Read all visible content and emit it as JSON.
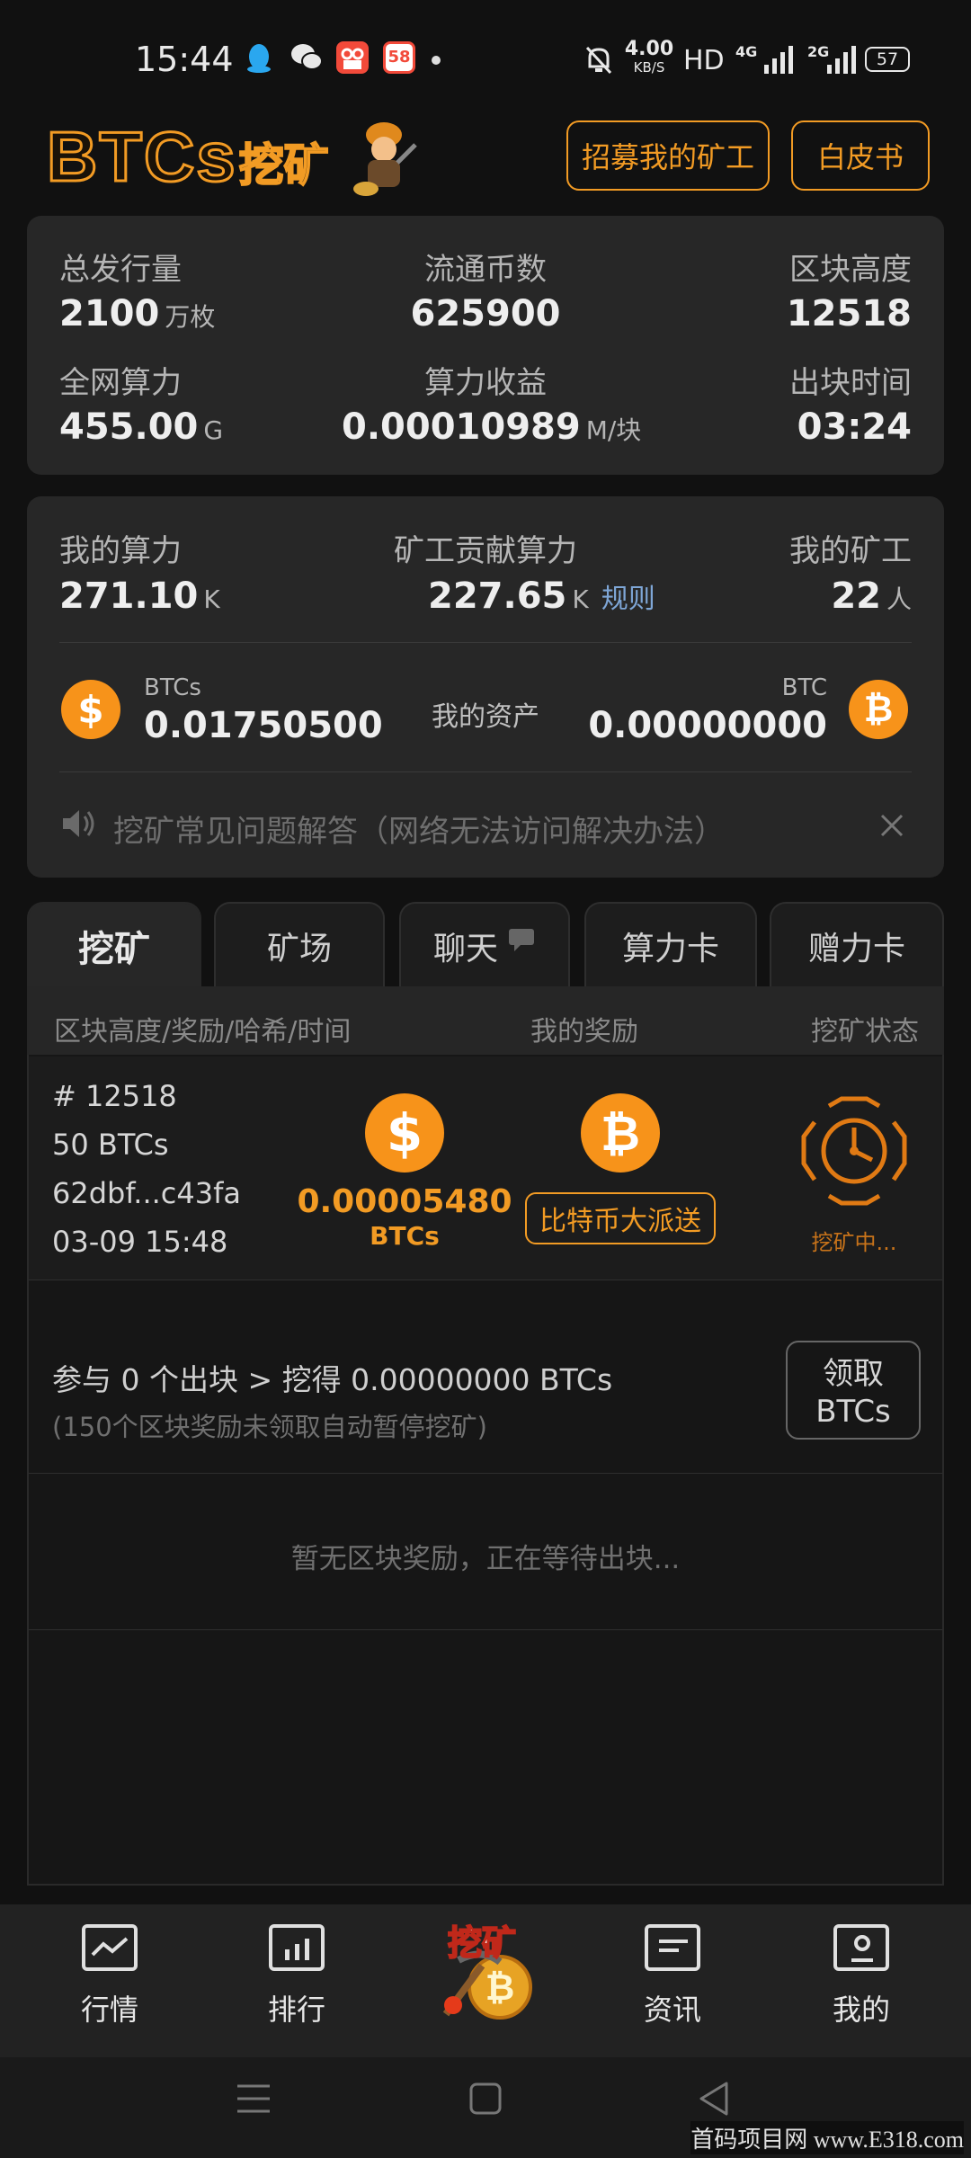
{
  "status_bar": {
    "time": "15:44",
    "net_speed_value": "4.00",
    "net_speed_unit": "KB/S",
    "hd_label": "HD",
    "sig1_label": "4G",
    "sig2_label": "2G",
    "battery": "57",
    "icons": [
      "qq-icon",
      "wechat-icon",
      "video-app-icon",
      "58-app-icon",
      "mute-bell-icon"
    ]
  },
  "header": {
    "logo_text": "BTCs",
    "logo_cn": "挖矿",
    "recruit_button": "招募我的矿工",
    "whitepaper_button": "白皮书",
    "accent_color": "#f29b24"
  },
  "stats": {
    "total_supply_label": "总发行量",
    "total_supply_value": "2100",
    "total_supply_unit": "万枚",
    "circulating_label": "流通币数",
    "circulating_value": "625900",
    "block_height_label": "区块高度",
    "block_height_value": "12518",
    "network_hash_label": "全网算力",
    "network_hash_value": "455.00",
    "network_hash_unit": "G",
    "hash_income_label": "算力收益",
    "hash_income_value": "0.00010989",
    "hash_income_unit": "M/块",
    "block_time_label": "出块时间",
    "block_time_value": "03:24"
  },
  "my": {
    "my_hash_label": "我的算力",
    "my_hash_value": "271.10",
    "my_hash_unit": "K",
    "miner_contrib_label": "矿工贡献算力",
    "miner_contrib_value": "227.65",
    "miner_contrib_unit": "K",
    "rules_link": "规则",
    "my_miners_label": "我的矿工",
    "my_miners_value": "22",
    "my_miners_unit": "人",
    "btcs_label": "BTCs",
    "btcs_balance": "0.01750500",
    "assets_label": "我的资产",
    "btc_label": "BTC",
    "btc_balance": "0.00000000",
    "notice": "挖矿常见问题解答（网络无法访问解决办法）"
  },
  "tabs": [
    {
      "label": "挖矿",
      "active": true
    },
    {
      "label": "矿场",
      "active": false
    },
    {
      "label": "聊天",
      "active": false
    },
    {
      "label": "算力卡",
      "active": false
    },
    {
      "label": "赠力卡",
      "active": false
    }
  ],
  "table": {
    "col1": "区块高度/奖励/哈希/时间",
    "col2": "我的奖励",
    "col3": "挖矿状态"
  },
  "block_row": {
    "height": "# 12518",
    "reward": "50 BTCs",
    "hash": "62dbf...c43fa",
    "time": "03-09 15:48",
    "my_reward": "0.00005480",
    "my_reward_unit": "BTCs",
    "airdrop_button": "比特币大派送",
    "status": "挖矿中..."
  },
  "participation": {
    "summary": "参与 0 个出块 > 挖得 0.00000000 BTCs",
    "note": "(150个区块奖励未领取自动暂停挖矿)",
    "claim_line1": "领取",
    "claim_line2": "BTCs"
  },
  "empty_message": "暂无区块奖励，正在等待出块...",
  "bottom_nav": {
    "market": "行情",
    "ranking": "排行",
    "mining": "挖矿",
    "news": "资讯",
    "mine": "我的"
  },
  "watermark": "首码项目网 www.E318.com"
}
